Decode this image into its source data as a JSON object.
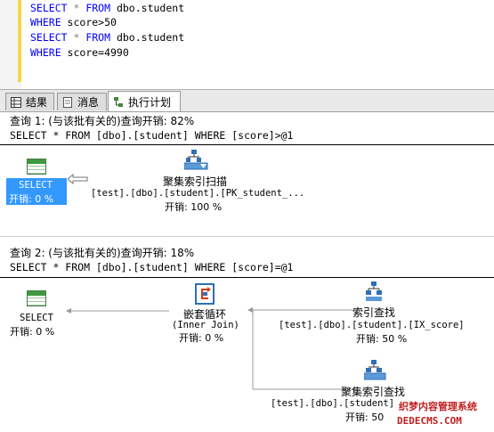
{
  "editor": {
    "lines": [
      {
        "kw1": "SELECT",
        "op": " * ",
        "kw2": "FROM",
        "rest": " dbo.student"
      },
      {
        "kw1": "WHERE",
        "rest": " score>50"
      },
      {
        "kw1": "SELECT",
        "op": " * ",
        "kw2": "FROM",
        "rest": " dbo.student"
      },
      {
        "kw1": "WHERE",
        "rest": " score=4990"
      }
    ]
  },
  "tabs": [
    {
      "label": "结果",
      "icon": "grid-icon"
    },
    {
      "label": "消息",
      "icon": "message-icon"
    },
    {
      "label": "执行计划",
      "icon": "plan-icon",
      "active": true
    }
  ],
  "query1": {
    "header": "查询 1: (与该批有关的)查询开销: 82%",
    "sql": "SELECT * FROM [dbo].[student] WHERE [score]>@1",
    "select_node": {
      "label": "SELECT",
      "cost": "开销: 0 %"
    },
    "scan_node": {
      "title": "聚集索引扫描",
      "detail": "[test].[dbo].[student].[PK_student_...",
      "cost": "开销: 100 %"
    }
  },
  "query2": {
    "header": "查询 2: (与该批有关的)查询开销: 18%",
    "sql": "SELECT * FROM [dbo].[student] WHERE [score]=@1",
    "select_node": {
      "label": "SELECT",
      "cost": "开销: 0 %"
    },
    "loop_node": {
      "title": "嵌套循环",
      "sub": "(Inner Join)",
      "cost": "开销: 0 %"
    },
    "seek_node": {
      "title": "索引查找",
      "detail": "[test].[dbo].[student].[IX_score]",
      "cost": "开销: 50 %"
    },
    "cseek_node": {
      "title": "聚集索引查找",
      "detail": "[test].[dbo].[student]",
      "cost": "开销: 50"
    }
  },
  "watermark": {
    "line1": "织梦内容管理系统",
    "line2": "DEDECMS.COM"
  }
}
